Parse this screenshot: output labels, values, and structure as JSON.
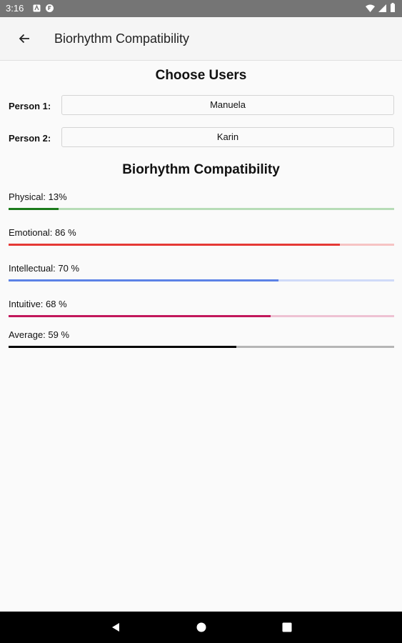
{
  "status_bar": {
    "time": "3:16",
    "icons": [
      "notification-a-icon",
      "notification-b-icon",
      "wifi-icon",
      "signal-icon",
      "battery-icon"
    ]
  },
  "app_bar": {
    "title": "Biorhythm Compatibility",
    "back_icon": "arrow-back-icon"
  },
  "choose_users": {
    "heading": "Choose Users",
    "person1_label": "Person 1:",
    "person1_value": "Manuela",
    "person2_label": "Person 2:",
    "person2_value": "Karin"
  },
  "compatibility": {
    "heading": "Biorhythm Compatibility",
    "metrics": [
      {
        "label": "Physical: 13%",
        "progress": 0.13,
        "color": "#1b7a1b",
        "track_color": "#b7dcb7"
      },
      {
        "label": "Emotional: 86 %",
        "progress": 0.86,
        "color": "#e53935",
        "track_color": "#f6c3c3"
      },
      {
        "label": "Intellectual: 70 %",
        "progress": 0.7,
        "color": "#5b82e6",
        "track_color": "#cfdaf8"
      },
      {
        "label": "Intuitive: 68 %",
        "progress": 0.68,
        "color": "#c2185b",
        "track_color": "#eec2d3"
      },
      {
        "label": "Average: 59 %",
        "progress": 0.59,
        "color": "#000000",
        "track_color": "#b5b5b5"
      }
    ]
  },
  "nav_bar": {
    "icons": [
      "nav-back-icon",
      "nav-home-icon",
      "nav-recents-icon"
    ]
  }
}
